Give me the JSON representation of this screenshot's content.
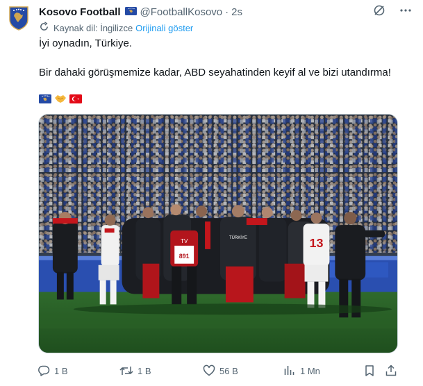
{
  "tweet": {
    "author_name": "Kosovo Football",
    "handle": "@FootballKosovo",
    "separator": "·",
    "time": "2s",
    "translation": {
      "source_label": "Kaynak dil: İngilizce",
      "show_original": "Orijinali göster"
    },
    "text_line_1": "İyi oynadın, Türkiye.",
    "text_line_2": "Bir dahaki görüşmemize kadar, ABD seyahatinden keyif al ve bizi utandırma!",
    "emojis": [
      "kosovo-flag",
      "handshake",
      "turkey-flag"
    ],
    "photo": {
      "tv_text": "TV",
      "bib_number": "891",
      "jersey_number": "13",
      "jacket_text": "TÜRKİYE"
    }
  },
  "actions": {
    "replies": "1 B",
    "reposts": "1 B",
    "likes": "56 B",
    "views": "1 Mn"
  },
  "colors": {
    "text": "#0f1419",
    "secondary": "#536471",
    "link": "#1d9bf0",
    "kosovo_blue": "#244aa5",
    "kosovo_gold": "#d0a650",
    "turkey_red": "#e30a17"
  }
}
